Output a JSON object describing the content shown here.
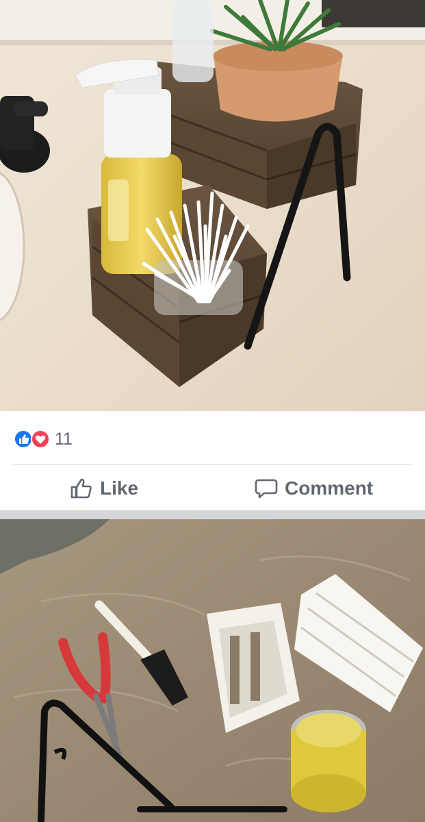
{
  "post1": {
    "photo_icon": "bathroom-organizer-photo",
    "reaction_icons": [
      "like-reaction-icon",
      "love-reaction-icon"
    ],
    "reaction_count": "11",
    "actions": {
      "like_label": "Like",
      "comment_label": "Comment"
    }
  },
  "post2": {
    "photo_icon": "craft-supplies-photo"
  },
  "colors": {
    "like_blue": "#1877f2",
    "love_red": "#f33e58",
    "action_gray": "#606770"
  }
}
